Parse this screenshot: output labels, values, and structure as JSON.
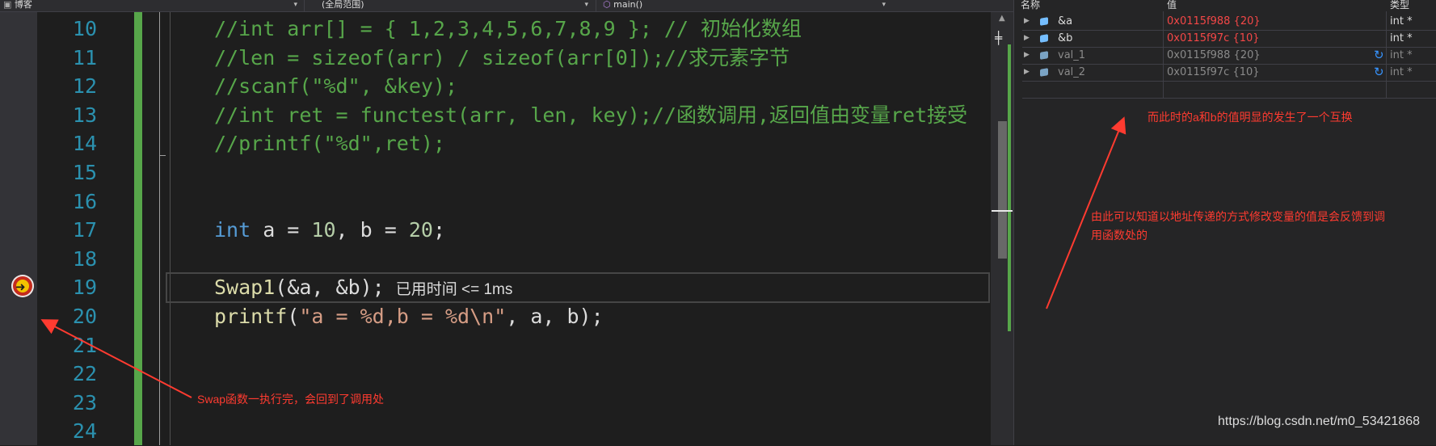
{
  "toolbar": {
    "project": "博客",
    "scope": "(全局范围)",
    "function": "main()"
  },
  "editor": {
    "lines": [
      {
        "num": "10",
        "parts": [
          {
            "t": "//int arr[] = { 1,2,3,4,5,6,7,8,9 }; // 初始化数组",
            "c": "cm"
          }
        ]
      },
      {
        "num": "11",
        "parts": [
          {
            "t": "//len = sizeof(arr) / sizeof(arr[0]);//求元素字节",
            "c": "cm"
          }
        ]
      },
      {
        "num": "12",
        "parts": [
          {
            "t": "//scanf(\"%d\", &key);",
            "c": "cm"
          }
        ]
      },
      {
        "num": "13",
        "parts": [
          {
            "t": "//int ret = functest(arr, len, key);//函数调用,返回值由变量ret接受",
            "c": "cm"
          }
        ]
      },
      {
        "num": "14",
        "parts": [
          {
            "t": "//printf(\"%d\",ret);",
            "c": "cm"
          }
        ]
      },
      {
        "num": "15",
        "parts": []
      },
      {
        "num": "16",
        "parts": []
      },
      {
        "num": "17",
        "parts": [
          {
            "t": "int",
            "c": "kw"
          },
          {
            "t": " a = ",
            "c": ""
          },
          {
            "t": "10",
            "c": "num"
          },
          {
            "t": ", b = ",
            "c": ""
          },
          {
            "t": "20",
            "c": "num"
          },
          {
            "t": ";",
            "c": ""
          }
        ]
      },
      {
        "num": "18",
        "parts": []
      },
      {
        "num": "19",
        "parts": [
          {
            "t": "Swap1",
            "c": "fn"
          },
          {
            "t": "(&a, &b);",
            "c": ""
          }
        ]
      },
      {
        "num": "20",
        "parts": [
          {
            "t": "printf",
            "c": "fn"
          },
          {
            "t": "(",
            "c": ""
          },
          {
            "t": "\"a = %d,b = %d\\n\"",
            "c": "str"
          },
          {
            "t": ", a, b);",
            "c": ""
          }
        ]
      },
      {
        "num": "21",
        "parts": []
      },
      {
        "num": "22",
        "parts": []
      },
      {
        "num": "23",
        "parts": []
      },
      {
        "num": "24",
        "parts": []
      }
    ],
    "perf_hint": "已用时间 <= 1ms"
  },
  "watch": {
    "headers": {
      "name": "名称",
      "value": "值",
      "type": "类型"
    },
    "rows": [
      {
        "name": "&a",
        "value": "0x0115f988 {20}",
        "type": "int *",
        "stale": false
      },
      {
        "name": "&b",
        "value": "0x0115f97c {10}",
        "type": "int *",
        "stale": false
      },
      {
        "name": "val_1",
        "value": "0x0115f988 {20}",
        "type": "int *",
        "stale": true
      },
      {
        "name": "val_2",
        "value": "0x0115f97c {10}",
        "type": "int *",
        "stale": true
      }
    ]
  },
  "annotations": {
    "swap_note": "Swap函数一执行完，会回到了调用处",
    "values_note": "而此时的a和b的值明显的发生了一个互换",
    "address_note_line1": "由此可以知道以地址传递的方式修改变量的值是会反馈到调",
    "address_note_line2": "用函数处的"
  },
  "watermark": "https://blog.csdn.net/m0_53421868",
  "colors": {
    "annotation": "#ff3b30",
    "comment": "#57a64a",
    "keyword": "#569cd6",
    "function": "#dcdcaa",
    "number": "#b5cea8",
    "string": "#d69d85",
    "line_number": "#2b91af",
    "watch_value": "#f44747"
  }
}
